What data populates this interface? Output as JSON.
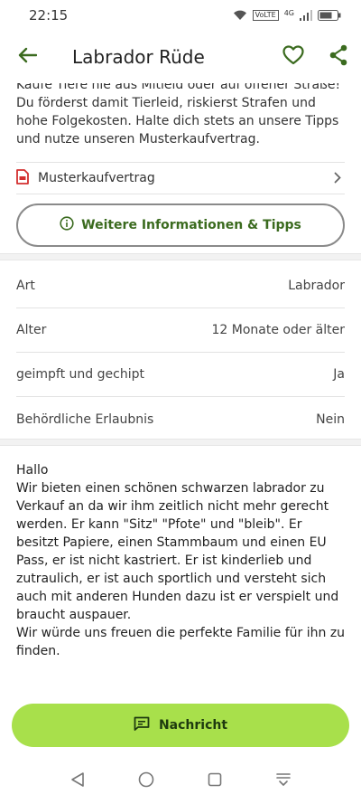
{
  "status": {
    "time": "22:15",
    "volte": "VoLTE",
    "network": "4G"
  },
  "header": {
    "title": "Labrador Rüde"
  },
  "intro_text": "Kaufe Tiere nie aus Mitleid oder auf offener Straße! Du förderst damit Tierleid, riskierst Strafen und hohe Folgekosten. Halte dich stets an unsere Tipps und nutze unseren Musterkaufvertrag.",
  "contract": {
    "label": "Musterkaufvertrag"
  },
  "info_button": {
    "label": "Weitere Informationen & Tipps"
  },
  "details": [
    {
      "label": "Art",
      "value": "Labrador"
    },
    {
      "label": "Alter",
      "value": "12 Monate oder älter"
    },
    {
      "label": "geimpft und gechipt",
      "value": "Ja"
    },
    {
      "label": "Behördliche Erlaubnis",
      "value": "Nein"
    }
  ],
  "description": "Hallo\nWir bieten einen schönen schwarzen labrador zu Verkauf an da wir ihm zeitlich nicht mehr gerecht werden. Er kann \"Sitz\" \"Pfote\" und \"bleib\". Er besitzt Papiere, einen Stammbaum und einen EU Pass, er ist nicht kastriert. Er ist kinderlieb und zutraulich, er ist auch sportlich und versteht sich auch mit anderen Hunden dazu ist er verspielt und braucht auspauer.\nWir würde uns freuen die perfekte Familie für ihn zu finden.",
  "message_button": {
    "label": "Nachricht"
  },
  "colors": {
    "accent_green": "#3b6b1f",
    "button_lime": "#a8e04b",
    "pdf_red": "#d32f2f"
  }
}
